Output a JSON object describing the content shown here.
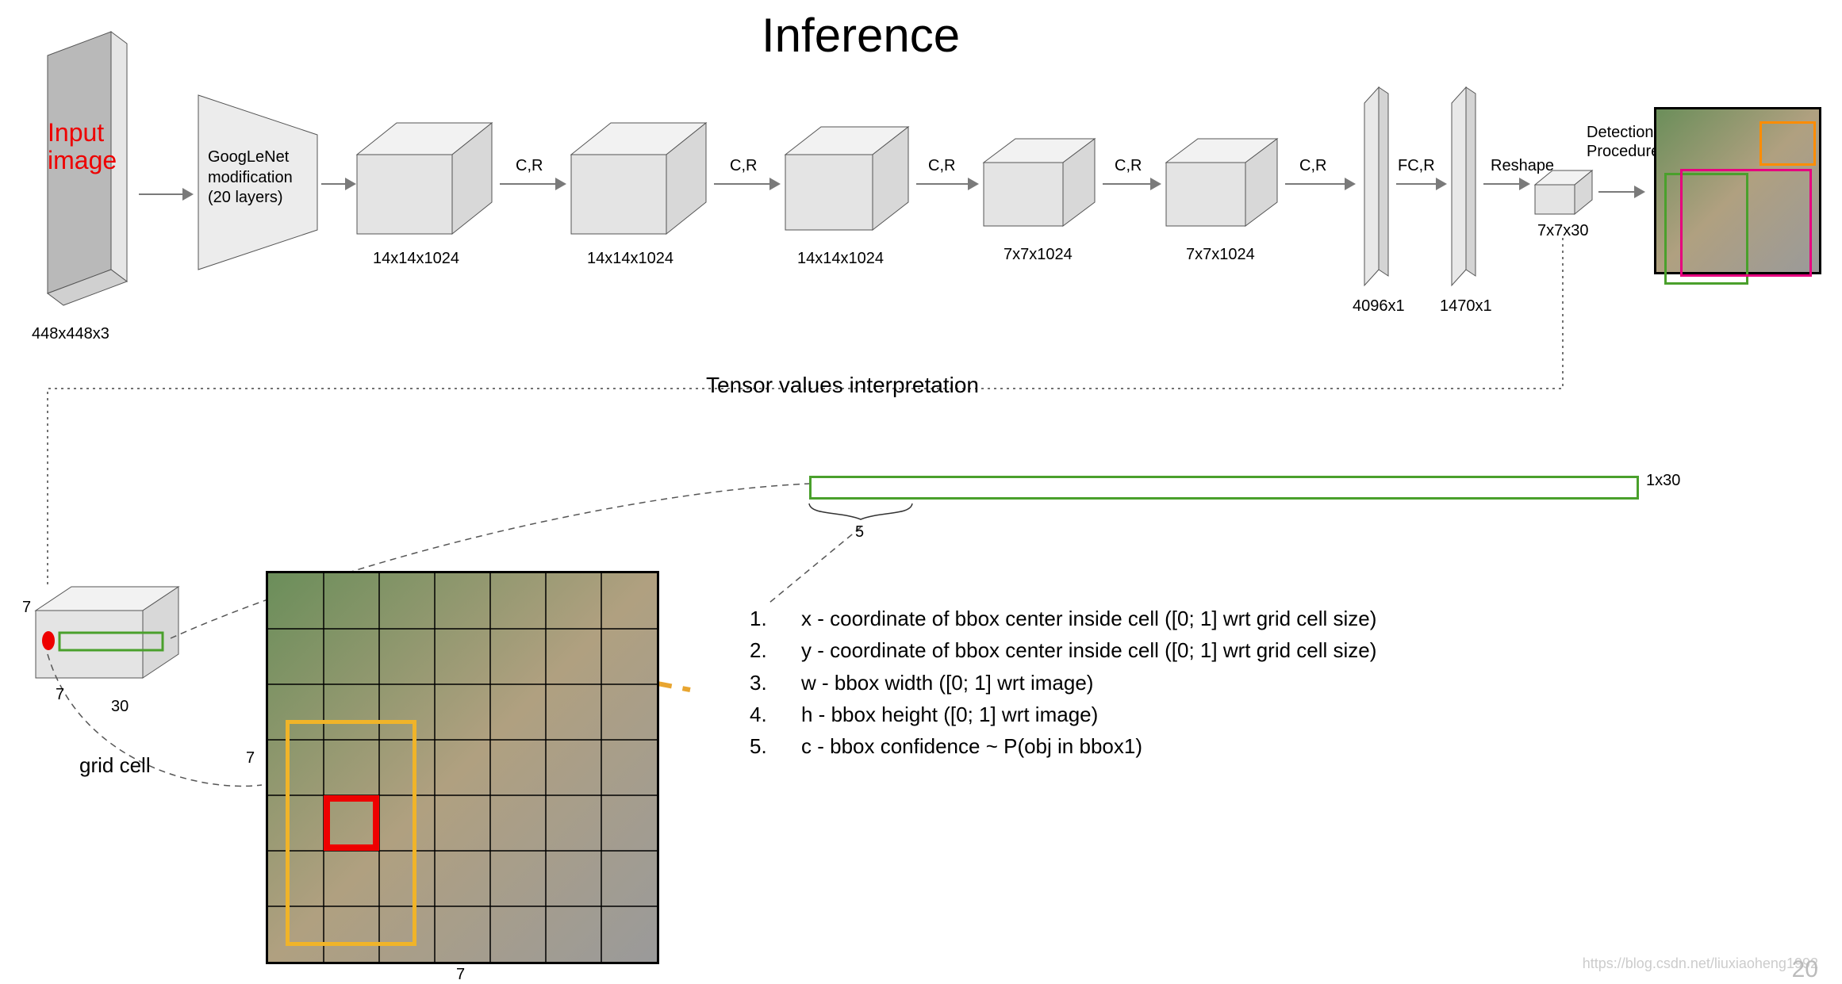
{
  "title": "Inference",
  "input_label": "Input image",
  "input_dim": "448x448x3",
  "backbone": {
    "name": "GoogLeNet modification",
    "layers": "(20 layers)"
  },
  "blocks": [
    {
      "dim": "14x14x1024",
      "op": "C,R"
    },
    {
      "dim": "14x14x1024",
      "op": "C,R"
    },
    {
      "dim": "14x14x1024",
      "op": "C,R"
    },
    {
      "dim": "7x7x1024",
      "op": "C,R"
    },
    {
      "dim": "7x7x1024",
      "op": "C,R"
    }
  ],
  "fc": [
    {
      "dim": "4096x1",
      "op": "FC,R"
    },
    {
      "dim": "1470x1",
      "op": "FC"
    }
  ],
  "reshape_label": "Reshape",
  "output_tensor": "7x7x30",
  "detection_label": "Detection Procedure",
  "section2_title": "Tensor values interpretation",
  "vector_dim": "1x30",
  "vector_brace": "5",
  "grid_label": "grid cell",
  "tensor_dims": {
    "h": "7",
    "w": "7",
    "d": "30"
  },
  "grid_w": "7",
  "grid_h": "7",
  "interp": [
    {
      "n": "1.",
      "txt": "x - coordinate of bbox center inside cell ([0; 1] wrt grid cell size)"
    },
    {
      "n": "2.",
      "txt": "y - coordinate of bbox center inside cell ([0; 1] wrt grid cell size)"
    },
    {
      "n": "3.",
      "txt": "w - bbox width ([0; 1] wrt image)"
    },
    {
      "n": "4.",
      "txt": "h - bbox height ([0; 1] wrt image)"
    },
    {
      "n": "5.",
      "txt": "c - bbox confidence ~ P(obj in bbox1)"
    }
  ],
  "watermark": "https://blog.csdn.net/liuxiaoheng1992",
  "slide_no": "20"
}
